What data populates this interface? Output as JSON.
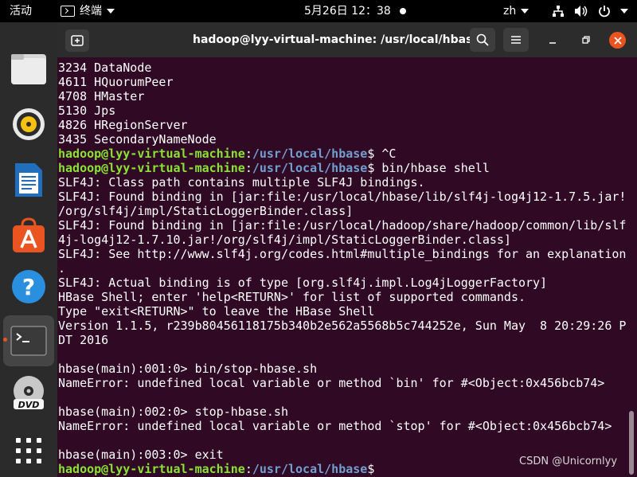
{
  "topbar": {
    "activities": "活动",
    "app_name": "终端",
    "clock": "5月26日  12：38",
    "language": "zh"
  },
  "dock": {
    "items": [
      "files",
      "rhythmbox",
      "libreoffice-writer",
      "ubuntu-software",
      "help",
      "terminal",
      "dvd"
    ]
  },
  "window": {
    "title": "hadoop@lyy-virtual-machine: /usr/local/hbase"
  },
  "terminal": {
    "lines": [
      {
        "text": "3234 DataNode"
      },
      {
        "text": "4611 HQuorumPeer"
      },
      {
        "text": "4708 HMaster"
      },
      {
        "text": "5130 Jps"
      },
      {
        "text": "4826 HRegionServer"
      },
      {
        "text": "3435 SecondaryNameNode"
      },
      {
        "prompt": {
          "user": "hadoop@lyy-virtual-machine",
          "sep": ":",
          "path": "/usr/local/hbase",
          "sign": "$ "
        },
        "text": "^C"
      },
      {
        "prompt": {
          "user": "hadoop@lyy-virtual-machine",
          "sep": ":",
          "path": "/usr/local/hbase",
          "sign": "$ "
        },
        "text": "bin/hbase shell"
      },
      {
        "text": "SLF4J: Class path contains multiple SLF4J bindings."
      },
      {
        "text": "SLF4J: Found binding in [jar:file:/usr/local/hbase/lib/slf4j-log4j12-1.7.5.jar!"
      },
      {
        "text": "/org/slf4j/impl/StaticLoggerBinder.class]"
      },
      {
        "text": "SLF4J: Found binding in [jar:file:/usr/local/hadoop/share/hadoop/common/lib/slf"
      },
      {
        "text": "4j-log4j12-1.7.10.jar!/org/slf4j/impl/StaticLoggerBinder.class]"
      },
      {
        "text": "SLF4J: See http://www.slf4j.org/codes.html#multiple_bindings for an explanation"
      },
      {
        "text": "."
      },
      {
        "text": "SLF4J: Actual binding is of type [org.slf4j.impl.Log4jLoggerFactory]"
      },
      {
        "text": "HBase Shell; enter 'help<RETURN>' for list of supported commands."
      },
      {
        "text": "Type \"exit<RETURN>\" to leave the HBase Shell"
      },
      {
        "text": "Version 1.1.5, r239b80456118175b340b2e562a5568b5c744252e, Sun May  8 20:29:26 P"
      },
      {
        "text": "DT 2016"
      },
      {
        "text": ""
      },
      {
        "text": "hbase(main):001:0> bin/stop-hbase.sh"
      },
      {
        "text": "NameError: undefined local variable or method `bin' for #<Object:0x456bcb74>"
      },
      {
        "text": ""
      },
      {
        "text": "hbase(main):002:0> stop-hbase.sh"
      },
      {
        "text": "NameError: undefined local variable or method `stop' for #<Object:0x456bcb74>"
      },
      {
        "text": ""
      },
      {
        "text": "hbase(main):003:0> exit"
      },
      {
        "prompt": {
          "user": "hadoop@lyy-virtual-machine",
          "sep": ":",
          "path": "/usr/local/hbase",
          "sign": "$"
        },
        "text": ""
      }
    ]
  },
  "watermark": "CSDN @Unicornlyy",
  "colors": {
    "terminal_bg": "#300a24",
    "prompt_user": "#8ae234",
    "prompt_path": "#729fcf",
    "accent": "#e95420"
  }
}
